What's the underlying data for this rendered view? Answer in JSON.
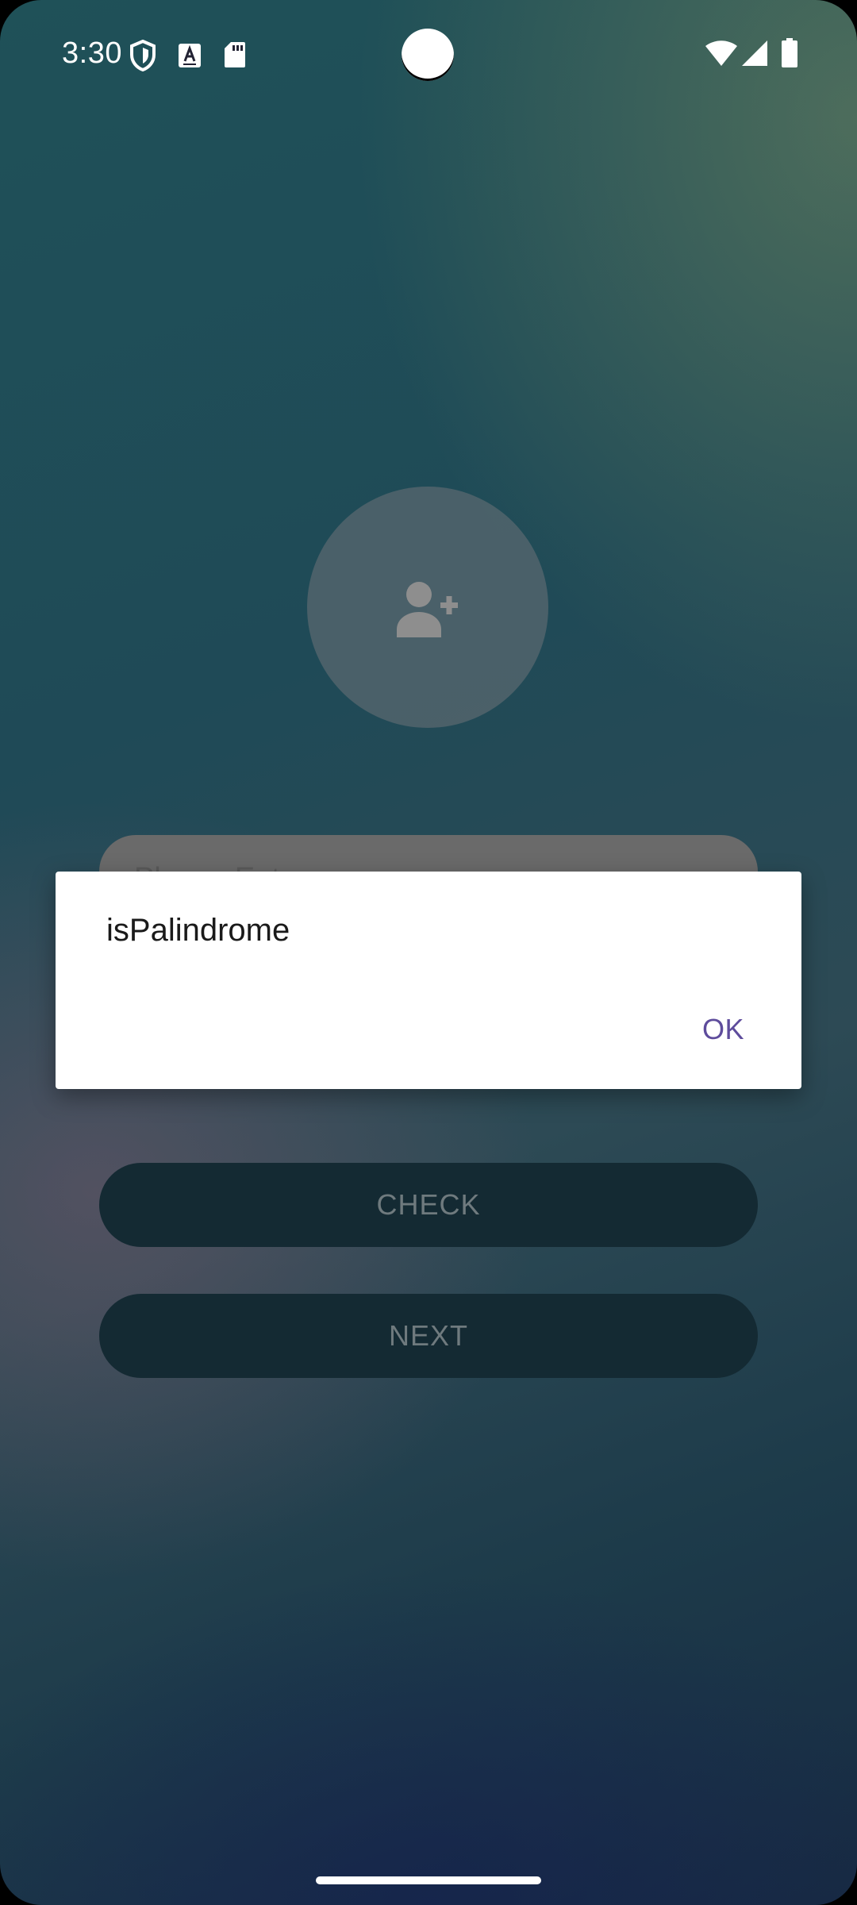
{
  "status_bar": {
    "time": "3:30",
    "icons": [
      "shield-icon",
      "keyboard-icon",
      "sd-card-icon",
      "wifi-icon",
      "cell-signal-icon",
      "battery-icon"
    ]
  },
  "avatar": {
    "icon": "add-person-icon"
  },
  "name_field": {
    "placeholder": "Please Enter your name"
  },
  "buttons": {
    "check_label": "CHECK",
    "next_label": "NEXT"
  },
  "dialog": {
    "title": "isPalindrome",
    "ok_label": "OK"
  },
  "colors": {
    "dialog_accent": "#5e4c9c",
    "button_bg": "#142a33",
    "button_text": "#6f7a7e"
  }
}
